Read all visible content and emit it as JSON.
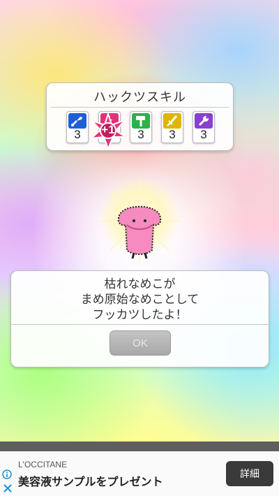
{
  "skill_panel": {
    "title": "ハックツスキル",
    "skills": [
      {
        "icon": "shovel-icon",
        "color": "#1f5fd6",
        "count": "3"
      },
      {
        "icon": "lightning-icon",
        "color": "#e0327a",
        "count": "3"
      },
      {
        "icon": "hammer-icon",
        "color": "#2bb24a",
        "count": "3"
      },
      {
        "icon": "sword-icon",
        "color": "#e0b400",
        "count": "3"
      },
      {
        "icon": "wrench-icon",
        "color": "#8a3fd0",
        "count": "3"
      }
    ],
    "bonus_badge": "+1"
  },
  "message": {
    "lines": [
      "枯れなめこが",
      "まめ原始なめことして",
      "フッカツしたよ！"
    ],
    "ok_label": "OK"
  },
  "ad": {
    "brand": "L'OCCITANE",
    "headline": "美容液サンプルをプレゼント",
    "detail_label": "詳細"
  },
  "colors": {
    "nameko_pink": "#f58bbf",
    "badge_pink": "#e8337a"
  }
}
